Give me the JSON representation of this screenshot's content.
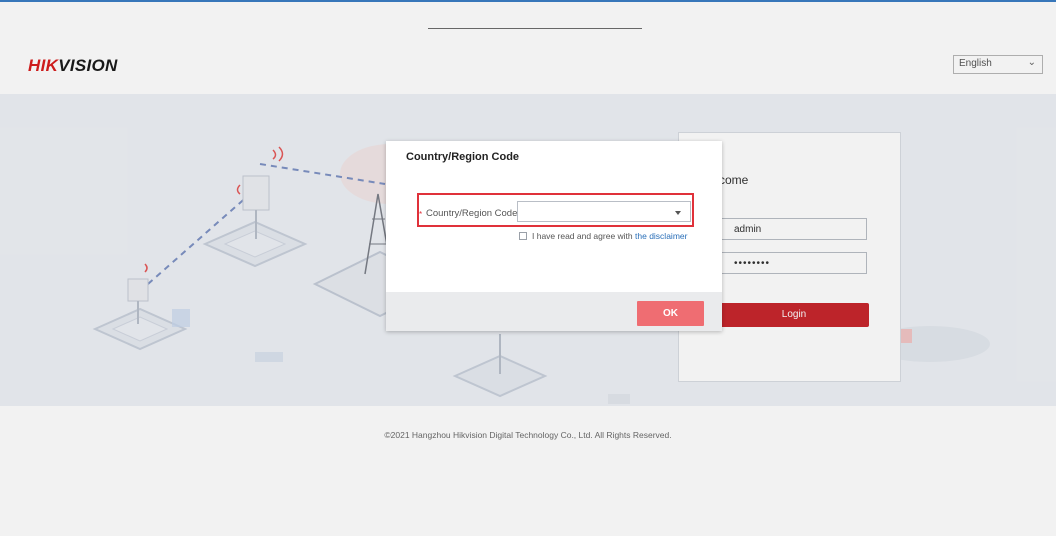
{
  "header": {
    "logo_hik": "HIK",
    "logo_vision": "VISION",
    "language_value": "English"
  },
  "login": {
    "welcome": "come",
    "username_value": "admin",
    "password_value": "••••••••",
    "login_button": "Login"
  },
  "footer": {
    "copyright": "©2021 Hangzhou Hikvision Digital Technology Co., Ltd. All Rights Reserved."
  },
  "dialog": {
    "title": "Country/Region Code",
    "required_mark": "*",
    "field_label": "Country/Region Code",
    "field_value": "",
    "agree_text": "I have read and agree with ",
    "disclaimer_link": "the disclaimer",
    "agree_checked": false,
    "ok_button": "OK"
  },
  "colors": {
    "brand_red": "#c8262d",
    "ok_button": "#ef6d72",
    "highlight": "#e0313a",
    "link": "#2a6fb8"
  }
}
